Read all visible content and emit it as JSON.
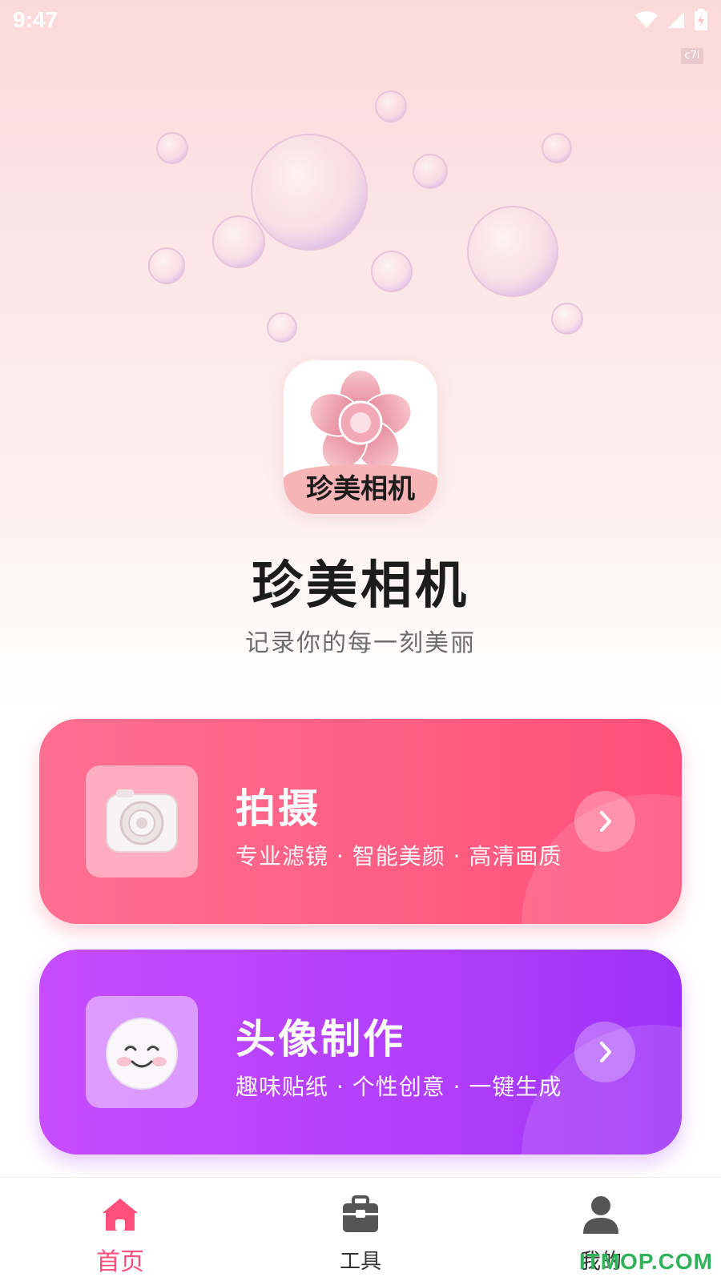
{
  "status_bar": {
    "time": "9:47",
    "icons": [
      "wifi-icon",
      "signal-icon",
      "battery-charging-icon"
    ]
  },
  "corner_tag": "c7i",
  "app": {
    "icon_text": "珍美相机",
    "title": "珍美相机",
    "slogan": "记录你的每一刻美丽"
  },
  "cards": [
    {
      "title": "拍摄",
      "subtitle": "专业滤镜 · 智能美颜 · 高清画质",
      "icon": "camera-icon",
      "arrow": "chevron-right-icon",
      "color": "#ff5a80"
    },
    {
      "title": "头像制作",
      "subtitle": "趣味贴纸 · 个性创意 · 一键生成",
      "icon": "smiley-face-icon",
      "arrow": "chevron-right-icon",
      "color": "#ad3cfb"
    }
  ],
  "tabs": [
    {
      "label": "首页",
      "icon": "home-icon",
      "active": true
    },
    {
      "label": "工具",
      "icon": "toolbox-icon",
      "active": false
    },
    {
      "label": "我的",
      "icon": "user-icon",
      "active": false
    }
  ],
  "watermark": "ITMOP.COM",
  "colors": {
    "accent": "#ff4f7a",
    "purple": "#ad3cfb",
    "tab_active": "#ff4f7a"
  }
}
